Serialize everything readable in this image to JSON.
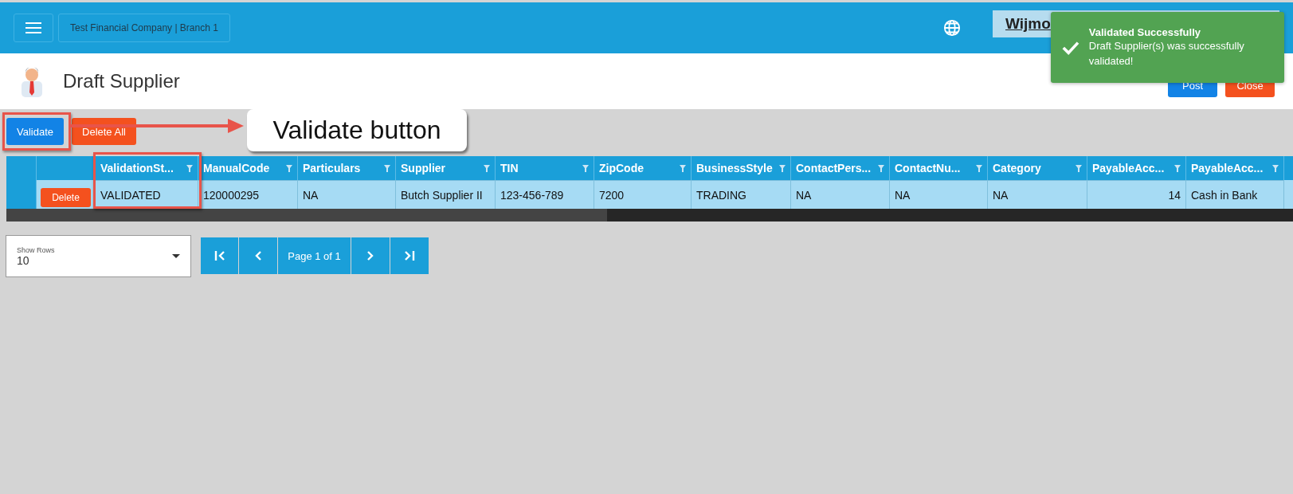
{
  "header": {
    "company": "Test Financial Company | Branch 1",
    "user_box": "Wijmo"
  },
  "page": {
    "title": "Draft Supplier",
    "actions": [
      {
        "label": "Post",
        "kind": "primary"
      },
      {
        "label": "Close",
        "kind": "danger"
      }
    ]
  },
  "toolbar": [
    {
      "label": "Validate",
      "kind": "primary"
    },
    {
      "label": "Delete All",
      "kind": "danger"
    }
  ],
  "table": {
    "columns": [
      "ValidationSt...",
      "ManualCode",
      "Particulars",
      "Supplier",
      "TIN",
      "ZipCode",
      "BusinessStyle",
      "ContactPers...",
      "ContactNu...",
      "Category",
      "PayableAcc...",
      "PayableAcc..."
    ],
    "rows": [
      {
        "action": "Delete",
        "cells": [
          "VALIDATED",
          "120000295",
          "NA",
          "Butch Supplier II",
          "123-456-789",
          "7200",
          "TRADING",
          "NA",
          "NA",
          "NA",
          "14",
          "Cash in Bank"
        ]
      }
    ]
  },
  "pager": {
    "show_rows_label": "Show Rows",
    "show_rows_value": "10",
    "page_text": "Page 1 of 1"
  },
  "toast": {
    "title": "Validated Successfully",
    "message": "Draft Supplier(s) was successfully validated!"
  },
  "annotation": {
    "callout": "Validate button"
  }
}
